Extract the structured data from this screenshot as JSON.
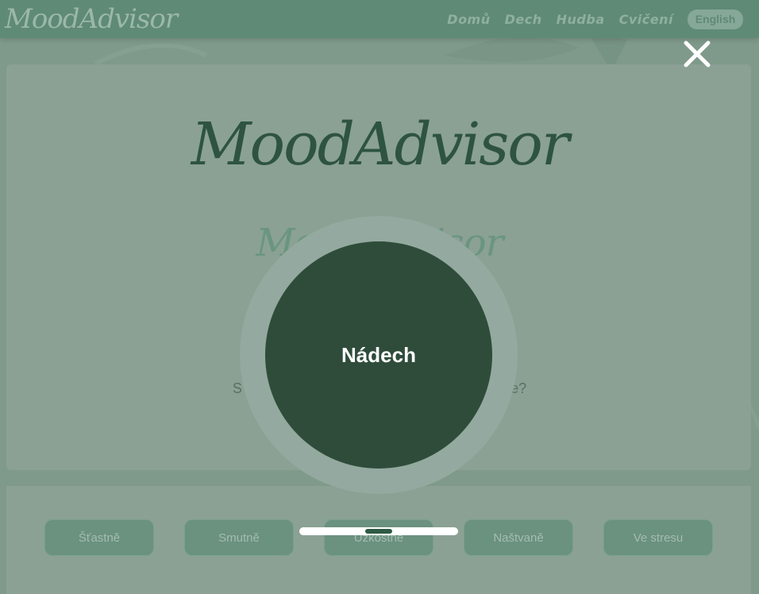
{
  "navbar": {
    "logo": "MoodAdvisor",
    "links": [
      "Domů",
      "Dech",
      "Hudba",
      "Cvičení"
    ],
    "language_button": "English"
  },
  "hero": {
    "title": "MoodAdvisor",
    "subtitle": "MoodAdvisor",
    "question": "S čím dnes potřebujete pomoct? Jak se cítíte?"
  },
  "moods": [
    "Šťastně",
    "Smutně",
    "Úzkostně",
    "Naštvaně",
    "Ve stresu"
  ],
  "breathing": {
    "phase_label": "Nádech",
    "progress": 0.5
  },
  "icons": {
    "close": "close-icon"
  },
  "colors": {
    "accent_dark": "#2f4c3b",
    "nav_bg": "#5f8a76",
    "overlay_ring": "#94a99f"
  }
}
